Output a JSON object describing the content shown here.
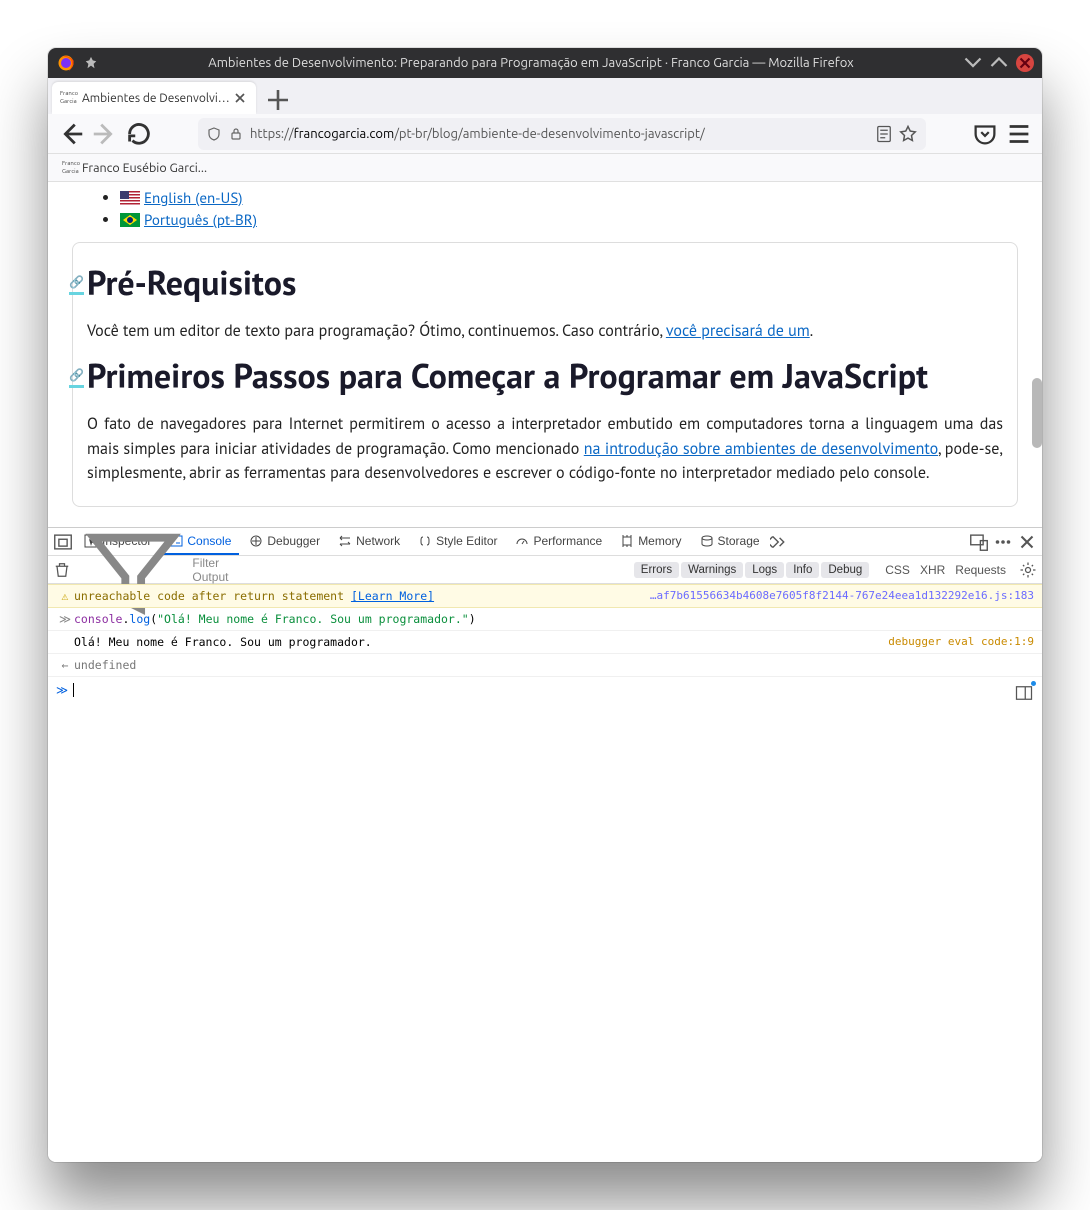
{
  "window": {
    "title": "Ambientes de Desenvolvimento: Preparando para Programação em JavaScript · Franco Garcia — Mozilla Firefox"
  },
  "tab": {
    "title": "Ambientes de Desenvolvimen",
    "favicon_top": "Franco",
    "favicon_bottom": "Garcia"
  },
  "url": {
    "scheme": "https://",
    "domain": "francogarcia.com",
    "path": "/pt-br/blog/ambiente-de-desenvolvimento-javascript/"
  },
  "bookmark": {
    "label": "Franco Eusébio Garci..."
  },
  "lang": {
    "en": "English (en-US)",
    "pt": "Português (pt-BR)"
  },
  "article": {
    "h1a": "Pré-Requisitos",
    "p1_a": "Você tem um editor de texto para programação? Ótimo, continuemos. Caso contrário, ",
    "p1_link": "você precisará de um",
    "p1_b": ".",
    "h1b": "Primeiros Passos para Começar a Programar em JavaScript",
    "p2_a": "O fato de navegadores para Internet permitirem o acesso a interpretador embutido em computadores torna a linguagem uma das mais simples para iniciar atividades de programação. Como mencionado ",
    "p2_link": "na introdução sobre ambientes de desenvolvimento",
    "p2_b": ", pode-se, simplesmente, abrir as ferramentas para desenvolvedores e escrever o código-fonte no interpretador mediado pelo console."
  },
  "devtools": {
    "tabs": {
      "inspector": "Inspector",
      "console": "Console",
      "debugger": "Debugger",
      "network": "Network",
      "style": "Style Editor",
      "perf": "Performance",
      "memory": "Memory",
      "storage": "Storage"
    },
    "filter_placeholder": "Filter Output",
    "chips": {
      "errors": "Errors",
      "warnings": "Warnings",
      "logs": "Logs",
      "info": "Info",
      "debug": "Debug"
    },
    "links": {
      "css": "CSS",
      "xhr": "XHR",
      "requests": "Requests"
    },
    "warn_msg": "unreachable code after return statement",
    "warn_learn": "[Learn More]",
    "warn_src": "…af7b61556634b4608e7605f8f2144-767e24eea1d132292e16.js:183",
    "log_obj": "console",
    "log_dot": ".",
    "log_fn": "log",
    "log_open": "(",
    "log_str": "\"Olá! Meu nome é Franco. Sou um programador.\"",
    "log_close": ")",
    "output": "Olá! Meu nome é Franco. Sou um programador.",
    "output_src": "debugger eval code:1:9",
    "undefined": "undefined"
  }
}
